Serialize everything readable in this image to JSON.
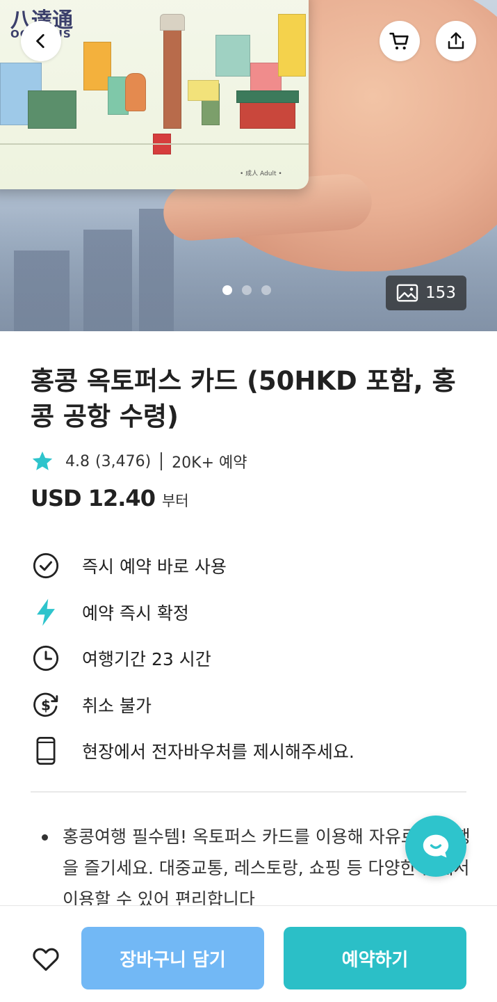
{
  "hero": {
    "card_logo_cn": "八達通",
    "card_logo_en": "OCTOPUS",
    "card_adult": "• 成人 Adult •",
    "photo_count": "153",
    "carousel_pages": 3,
    "carousel_active_index": 0
  },
  "product": {
    "title": "홍콩 옥토퍼스 카드 (50HKD 포함, 홍콩 공항 수령)",
    "rating": "4.8",
    "review_count": "(3,476)",
    "bookings": "20K+ 예약",
    "price": "USD 12.40",
    "price_suffix": "부터"
  },
  "features": [
    {
      "icon": "check-circle-icon",
      "label": "즉시 예약 바로 사용"
    },
    {
      "icon": "lightning-icon",
      "label": "예약 즉시 확정"
    },
    {
      "icon": "clock-icon",
      "label": "여행기간 23 시간"
    },
    {
      "icon": "no-refund-icon",
      "label": "취소 불가"
    },
    {
      "icon": "phone-icon",
      "label": "현장에서 전자바우처를 제시해주세요."
    }
  ],
  "description": "홍콩여행 필수템! 옥토퍼스 카드를 이용해 자유로운 여행을 즐기세요. 대중교통, 레스토랑, 쇼핑 등 다양한 곳에서 이용할 수 있어 편리합니다",
  "actions": {
    "add_to_cart": "장바구니 담기",
    "book_now": "예약하기"
  },
  "colors": {
    "accent": "#2bbfc7",
    "cart_button": "#72b8f5",
    "star": "#2ec4cc"
  }
}
